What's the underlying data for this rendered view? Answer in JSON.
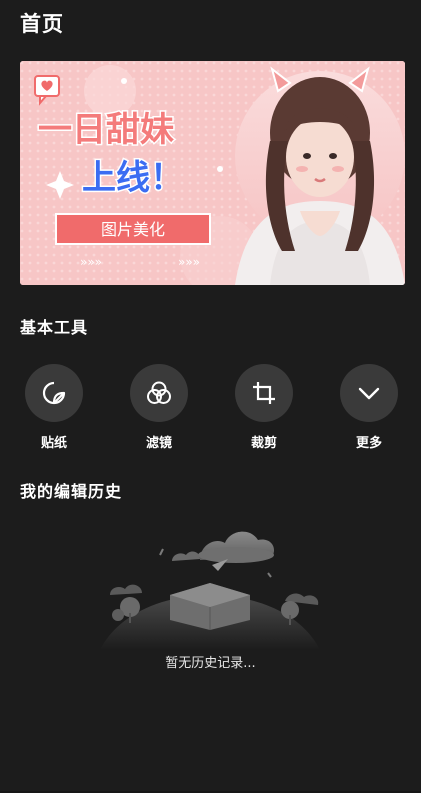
{
  "header": {
    "title": "首页"
  },
  "banner": {
    "headline_1": "一日甜妹",
    "headline_2": "上线！",
    "button_label": "图片美化"
  },
  "tools_section": {
    "title": "基本工具",
    "items": [
      {
        "label": "贴纸",
        "icon": "sticker-icon"
      },
      {
        "label": "滤镜",
        "icon": "filter-icon"
      },
      {
        "label": "裁剪",
        "icon": "crop-icon"
      },
      {
        "label": "更多",
        "icon": "chevron-down-icon"
      }
    ]
  },
  "history_section": {
    "title": "我的编辑历史",
    "empty_text": "暂无历史记录..."
  },
  "colors": {
    "background": "#1c1c1c",
    "tool_circle": "#3a3a3a",
    "banner_pink": "#f7c9c9",
    "banner_accent": "#f06b6b",
    "banner_blue": "#3b6df2"
  }
}
